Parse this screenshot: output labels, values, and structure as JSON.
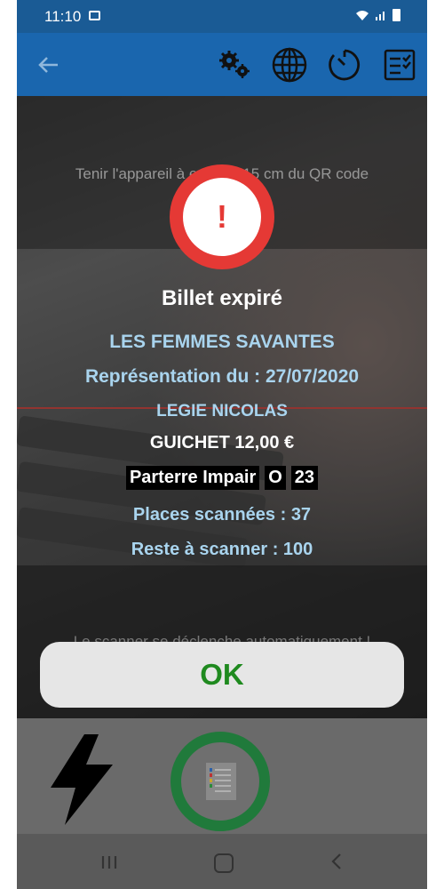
{
  "status_bar": {
    "time": "11:10"
  },
  "camera": {
    "hint_top": "Tenir l'appareil à environ 15 cm du QR code",
    "hint_bottom": "Le scanner se déclenche automatiquement !"
  },
  "dialog": {
    "alert_symbol": "!",
    "title": "Billet expiré",
    "show_name": "LES FEMMES SAVANTES",
    "performance": "Représentation du : 27/07/2020",
    "holder": "LEGIE NICOLAS",
    "ticket_type": "GUICHET 12,00 €",
    "seat": {
      "zone": "Parterre Impair",
      "row": "O",
      "number": "23"
    },
    "scanned": "Places scannées : 37",
    "remaining": "Reste à scanner : 100",
    "ok_label": "OK"
  },
  "colors": {
    "app_bar": "#1a66ae",
    "status_bar": "#1a5b95",
    "alert": "#e53935",
    "info_text": "#a9d4ee",
    "ok_text": "#1f8a1f",
    "scan_ring": "#207a3b"
  },
  "icons": [
    "back-arrow-icon",
    "gear-icon",
    "globe-icon",
    "timer-icon",
    "checklist-icon",
    "flash-icon",
    "document-icon"
  ]
}
